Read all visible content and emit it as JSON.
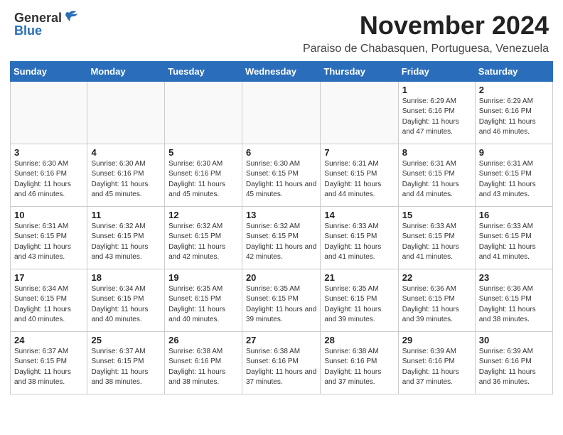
{
  "header": {
    "logo_general": "General",
    "logo_blue": "Blue",
    "month_title": "November 2024",
    "location": "Paraiso de Chabasquen, Portuguesa, Venezuela"
  },
  "days_of_week": [
    "Sunday",
    "Monday",
    "Tuesday",
    "Wednesday",
    "Thursday",
    "Friday",
    "Saturday"
  ],
  "weeks": [
    [
      {
        "day": null
      },
      {
        "day": null
      },
      {
        "day": null
      },
      {
        "day": null
      },
      {
        "day": null
      },
      {
        "day": "1",
        "sunrise": "6:29 AM",
        "sunset": "6:16 PM",
        "daylight": "11 hours and 47 minutes."
      },
      {
        "day": "2",
        "sunrise": "6:29 AM",
        "sunset": "6:16 PM",
        "daylight": "11 hours and 46 minutes."
      }
    ],
    [
      {
        "day": "3",
        "sunrise": "6:30 AM",
        "sunset": "6:16 PM",
        "daylight": "11 hours and 46 minutes."
      },
      {
        "day": "4",
        "sunrise": "6:30 AM",
        "sunset": "6:16 PM",
        "daylight": "11 hours and 45 minutes."
      },
      {
        "day": "5",
        "sunrise": "6:30 AM",
        "sunset": "6:16 PM",
        "daylight": "11 hours and 45 minutes."
      },
      {
        "day": "6",
        "sunrise": "6:30 AM",
        "sunset": "6:15 PM",
        "daylight": "11 hours and 45 minutes."
      },
      {
        "day": "7",
        "sunrise": "6:31 AM",
        "sunset": "6:15 PM",
        "daylight": "11 hours and 44 minutes."
      },
      {
        "day": "8",
        "sunrise": "6:31 AM",
        "sunset": "6:15 PM",
        "daylight": "11 hours and 44 minutes."
      },
      {
        "day": "9",
        "sunrise": "6:31 AM",
        "sunset": "6:15 PM",
        "daylight": "11 hours and 43 minutes."
      }
    ],
    [
      {
        "day": "10",
        "sunrise": "6:31 AM",
        "sunset": "6:15 PM",
        "daylight": "11 hours and 43 minutes."
      },
      {
        "day": "11",
        "sunrise": "6:32 AM",
        "sunset": "6:15 PM",
        "daylight": "11 hours and 43 minutes."
      },
      {
        "day": "12",
        "sunrise": "6:32 AM",
        "sunset": "6:15 PM",
        "daylight": "11 hours and 42 minutes."
      },
      {
        "day": "13",
        "sunrise": "6:32 AM",
        "sunset": "6:15 PM",
        "daylight": "11 hours and 42 minutes."
      },
      {
        "day": "14",
        "sunrise": "6:33 AM",
        "sunset": "6:15 PM",
        "daylight": "11 hours and 41 minutes."
      },
      {
        "day": "15",
        "sunrise": "6:33 AM",
        "sunset": "6:15 PM",
        "daylight": "11 hours and 41 minutes."
      },
      {
        "day": "16",
        "sunrise": "6:33 AM",
        "sunset": "6:15 PM",
        "daylight": "11 hours and 41 minutes."
      }
    ],
    [
      {
        "day": "17",
        "sunrise": "6:34 AM",
        "sunset": "6:15 PM",
        "daylight": "11 hours and 40 minutes."
      },
      {
        "day": "18",
        "sunrise": "6:34 AM",
        "sunset": "6:15 PM",
        "daylight": "11 hours and 40 minutes."
      },
      {
        "day": "19",
        "sunrise": "6:35 AM",
        "sunset": "6:15 PM",
        "daylight": "11 hours and 40 minutes."
      },
      {
        "day": "20",
        "sunrise": "6:35 AM",
        "sunset": "6:15 PM",
        "daylight": "11 hours and 39 minutes."
      },
      {
        "day": "21",
        "sunrise": "6:35 AM",
        "sunset": "6:15 PM",
        "daylight": "11 hours and 39 minutes."
      },
      {
        "day": "22",
        "sunrise": "6:36 AM",
        "sunset": "6:15 PM",
        "daylight": "11 hours and 39 minutes."
      },
      {
        "day": "23",
        "sunrise": "6:36 AM",
        "sunset": "6:15 PM",
        "daylight": "11 hours and 38 minutes."
      }
    ],
    [
      {
        "day": "24",
        "sunrise": "6:37 AM",
        "sunset": "6:15 PM",
        "daylight": "11 hours and 38 minutes."
      },
      {
        "day": "25",
        "sunrise": "6:37 AM",
        "sunset": "6:15 PM",
        "daylight": "11 hours and 38 minutes."
      },
      {
        "day": "26",
        "sunrise": "6:38 AM",
        "sunset": "6:16 PM",
        "daylight": "11 hours and 38 minutes."
      },
      {
        "day": "27",
        "sunrise": "6:38 AM",
        "sunset": "6:16 PM",
        "daylight": "11 hours and 37 minutes."
      },
      {
        "day": "28",
        "sunrise": "6:38 AM",
        "sunset": "6:16 PM",
        "daylight": "11 hours and 37 minutes."
      },
      {
        "day": "29",
        "sunrise": "6:39 AM",
        "sunset": "6:16 PM",
        "daylight": "11 hours and 37 minutes."
      },
      {
        "day": "30",
        "sunrise": "6:39 AM",
        "sunset": "6:16 PM",
        "daylight": "11 hours and 36 minutes."
      }
    ]
  ]
}
